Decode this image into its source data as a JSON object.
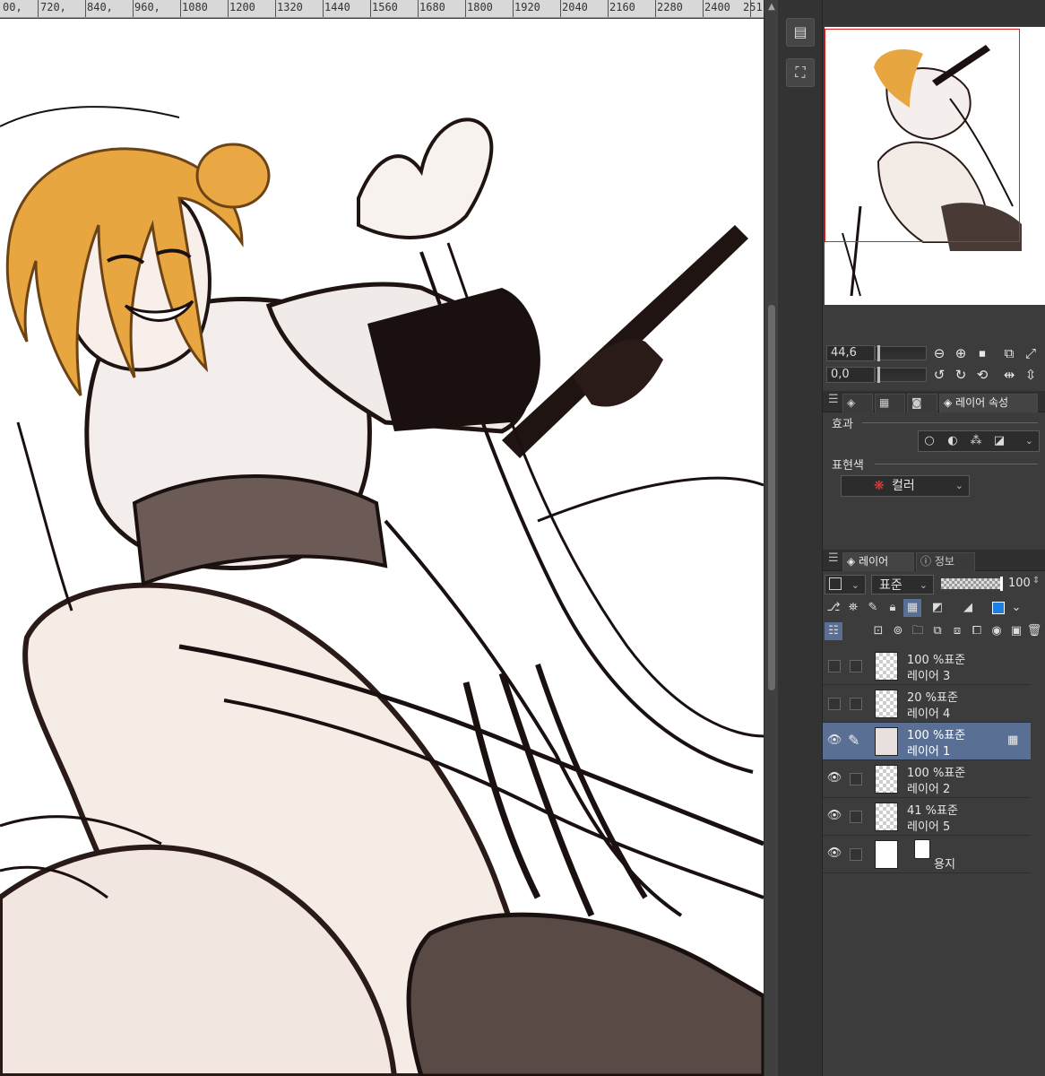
{
  "ruler": {
    "ticks": [
      "00,",
      "720,",
      "840,",
      "960,",
      "1080",
      "1200",
      "1320",
      "1440",
      "1560",
      "1680",
      "1800",
      "1920",
      "2040",
      "2160",
      "2280",
      "2400",
      "251"
    ]
  },
  "navigator": {
    "zoom_value": "44,6",
    "rotation_value": "0,0"
  },
  "property_panel": {
    "tab_label": "레이어 속성",
    "effect_label": "효과",
    "expression_color_label": "표현색",
    "color_mode_value": "컬러"
  },
  "layer_panel": {
    "tab_layer": "레이어",
    "tab_info": "정보",
    "blend_mode": "표준",
    "opacity": "100",
    "layers": [
      {
        "mode": "100 %표준",
        "name": "레이어 3",
        "visible": false,
        "selected": false
      },
      {
        "mode": "20 %표준",
        "name": "레이어 4",
        "visible": false,
        "selected": false
      },
      {
        "mode": "100 %표준",
        "name": "레이어 1",
        "visible": true,
        "selected": true
      },
      {
        "mode": "100 %표준",
        "name": "레이어 2",
        "visible": true,
        "selected": false
      },
      {
        "mode": "41 %표준",
        "name": "레이어 5",
        "visible": true,
        "selected": false
      }
    ],
    "paper_layer_name": "용지"
  },
  "colors": {
    "selected_layer": "#5a6f94",
    "panel_bg": "#3c3c3c",
    "navigator_frame": "#e02020"
  }
}
